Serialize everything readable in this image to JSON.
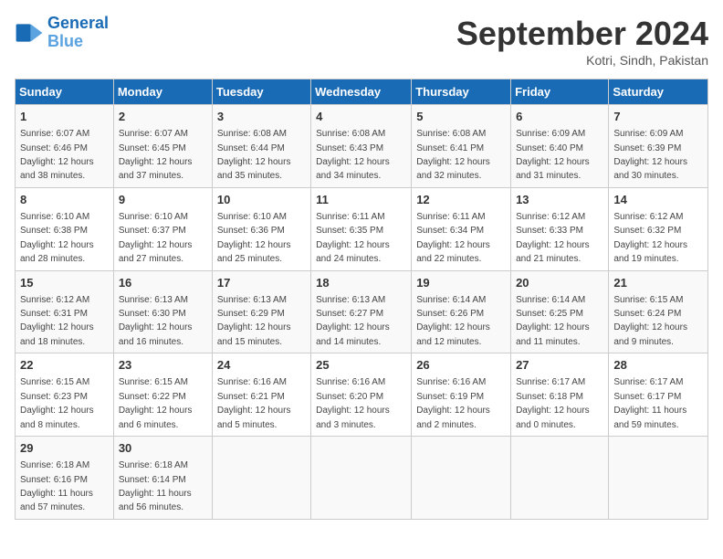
{
  "header": {
    "logo_line1": "General",
    "logo_line2": "Blue",
    "month": "September 2024",
    "location": "Kotri, Sindh, Pakistan"
  },
  "days_of_week": [
    "Sunday",
    "Monday",
    "Tuesday",
    "Wednesday",
    "Thursday",
    "Friday",
    "Saturday"
  ],
  "weeks": [
    [
      {
        "day": "1",
        "rise": "6:07 AM",
        "set": "6:46 PM",
        "daylight": "12 hours and 38 minutes."
      },
      {
        "day": "2",
        "rise": "6:07 AM",
        "set": "6:45 PM",
        "daylight": "12 hours and 37 minutes."
      },
      {
        "day": "3",
        "rise": "6:08 AM",
        "set": "6:44 PM",
        "daylight": "12 hours and 35 minutes."
      },
      {
        "day": "4",
        "rise": "6:08 AM",
        "set": "6:43 PM",
        "daylight": "12 hours and 34 minutes."
      },
      {
        "day": "5",
        "rise": "6:08 AM",
        "set": "6:41 PM",
        "daylight": "12 hours and 32 minutes."
      },
      {
        "day": "6",
        "rise": "6:09 AM",
        "set": "6:40 PM",
        "daylight": "12 hours and 31 minutes."
      },
      {
        "day": "7",
        "rise": "6:09 AM",
        "set": "6:39 PM",
        "daylight": "12 hours and 30 minutes."
      }
    ],
    [
      {
        "day": "8",
        "rise": "6:10 AM",
        "set": "6:38 PM",
        "daylight": "12 hours and 28 minutes."
      },
      {
        "day": "9",
        "rise": "6:10 AM",
        "set": "6:37 PM",
        "daylight": "12 hours and 27 minutes."
      },
      {
        "day": "10",
        "rise": "6:10 AM",
        "set": "6:36 PM",
        "daylight": "12 hours and 25 minutes."
      },
      {
        "day": "11",
        "rise": "6:11 AM",
        "set": "6:35 PM",
        "daylight": "12 hours and 24 minutes."
      },
      {
        "day": "12",
        "rise": "6:11 AM",
        "set": "6:34 PM",
        "daylight": "12 hours and 22 minutes."
      },
      {
        "day": "13",
        "rise": "6:12 AM",
        "set": "6:33 PM",
        "daylight": "12 hours and 21 minutes."
      },
      {
        "day": "14",
        "rise": "6:12 AM",
        "set": "6:32 PM",
        "daylight": "12 hours and 19 minutes."
      }
    ],
    [
      {
        "day": "15",
        "rise": "6:12 AM",
        "set": "6:31 PM",
        "daylight": "12 hours and 18 minutes."
      },
      {
        "day": "16",
        "rise": "6:13 AM",
        "set": "6:30 PM",
        "daylight": "12 hours and 16 minutes."
      },
      {
        "day": "17",
        "rise": "6:13 AM",
        "set": "6:29 PM",
        "daylight": "12 hours and 15 minutes."
      },
      {
        "day": "18",
        "rise": "6:13 AM",
        "set": "6:27 PM",
        "daylight": "12 hours and 14 minutes."
      },
      {
        "day": "19",
        "rise": "6:14 AM",
        "set": "6:26 PM",
        "daylight": "12 hours and 12 minutes."
      },
      {
        "day": "20",
        "rise": "6:14 AM",
        "set": "6:25 PM",
        "daylight": "12 hours and 11 minutes."
      },
      {
        "day": "21",
        "rise": "6:15 AM",
        "set": "6:24 PM",
        "daylight": "12 hours and 9 minutes."
      }
    ],
    [
      {
        "day": "22",
        "rise": "6:15 AM",
        "set": "6:23 PM",
        "daylight": "12 hours and 8 minutes."
      },
      {
        "day": "23",
        "rise": "6:15 AM",
        "set": "6:22 PM",
        "daylight": "12 hours and 6 minutes."
      },
      {
        "day": "24",
        "rise": "6:16 AM",
        "set": "6:21 PM",
        "daylight": "12 hours and 5 minutes."
      },
      {
        "day": "25",
        "rise": "6:16 AM",
        "set": "6:20 PM",
        "daylight": "12 hours and 3 minutes."
      },
      {
        "day": "26",
        "rise": "6:16 AM",
        "set": "6:19 PM",
        "daylight": "12 hours and 2 minutes."
      },
      {
        "day": "27",
        "rise": "6:17 AM",
        "set": "6:18 PM",
        "daylight": "12 hours and 0 minutes."
      },
      {
        "day": "28",
        "rise": "6:17 AM",
        "set": "6:17 PM",
        "daylight": "11 hours and 59 minutes."
      }
    ],
    [
      {
        "day": "29",
        "rise": "6:18 AM",
        "set": "6:16 PM",
        "daylight": "11 hours and 57 minutes."
      },
      {
        "day": "30",
        "rise": "6:18 AM",
        "set": "6:14 PM",
        "daylight": "11 hours and 56 minutes."
      },
      null,
      null,
      null,
      null,
      null
    ]
  ]
}
